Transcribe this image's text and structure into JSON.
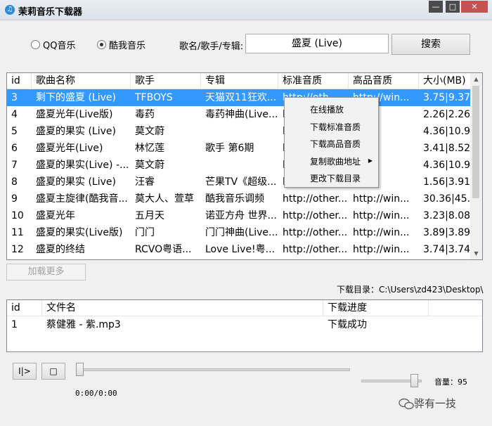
{
  "window": {
    "title": "茉莉音乐下载器"
  },
  "source": {
    "options": [
      "QQ音乐",
      "酷我音乐"
    ],
    "selected": 1
  },
  "search": {
    "label": "歌名/歌手/专辑:",
    "value": "盛夏 (Live)",
    "button": "搜索"
  },
  "results": {
    "columns": [
      "id",
      "歌曲名称",
      "歌手",
      "专辑",
      "标准音质",
      "高品音质",
      "大小(MB)"
    ],
    "rows": [
      [
        "3",
        "剩下的盛夏 (Live)",
        "TFBOYS",
        "天猫双11狂欢...",
        "http://oth...",
        "http://win...",
        "3.75|9.37"
      ],
      [
        "4",
        "盛夏光年(Live版)",
        "毒药",
        "毒药神曲(Live...",
        "h",
        "",
        "2.26|2.26"
      ],
      [
        "5",
        "盛夏的果实 (Live)",
        "莫文蔚",
        "",
        "h",
        "",
        "4.36|10.91"
      ],
      [
        "6",
        "盛夏光年(Live)",
        "林忆莲",
        "歌手 第6期",
        "h",
        "",
        "3.41|8.52"
      ],
      [
        "7",
        "盛夏的果实(Live) -...",
        "莫文蔚",
        "",
        "h",
        "",
        "4.36|10.91"
      ],
      [
        "8",
        "盛夏的果实 (Live)",
        "汪睿",
        "芒果TV《超级...",
        "h",
        "",
        "1.56|3.91"
      ],
      [
        "9",
        "盛夏主旋律(酷我音...",
        "莫大人、萱草",
        "酷我音乐调频",
        "http://other...",
        "http://win...",
        "30.36|45..."
      ],
      [
        "10",
        "盛夏光年",
        "五月天",
        "诺亚方舟 世界...",
        "http://other...",
        "http://win...",
        "3.23|8.08"
      ],
      [
        "11",
        "盛夏的果实(Live版)",
        "门门",
        "门门神曲(Live...",
        "http://other...",
        "http://win...",
        "3.89|3.89"
      ],
      [
        "12",
        "盛夏的终结",
        "RCVO粤语...",
        "Love Live!粤...",
        "http://other...",
        "http://win...",
        "3.74|3.74"
      ]
    ],
    "selected_row": 0
  },
  "context_menu": {
    "items": [
      "在线播放",
      "下载标准音质",
      "下载高品音质",
      "复制歌曲地址",
      "更改下载目录"
    ],
    "submenu_item": 3
  },
  "load_more": "加载更多",
  "download_dir": {
    "label": "下载目录：",
    "path": "C:\\Users\\zd423\\Desktop\\"
  },
  "downloads": {
    "columns": [
      "id",
      "文件名",
      "下载进度"
    ],
    "rows": [
      [
        "1",
        "蔡健雅 - 紫.mp3",
        "下载成功"
      ]
    ]
  },
  "player": {
    "play_pause": "I|>",
    "stop": "□",
    "time": "0:00/0:00",
    "progress": 0,
    "volume_label": "音量：",
    "volume_value": "95",
    "volume": 0.95
  },
  "watermark": "骅有一技",
  "icons": {
    "app": "music-app-icon",
    "watermark": "wechat-icon"
  }
}
